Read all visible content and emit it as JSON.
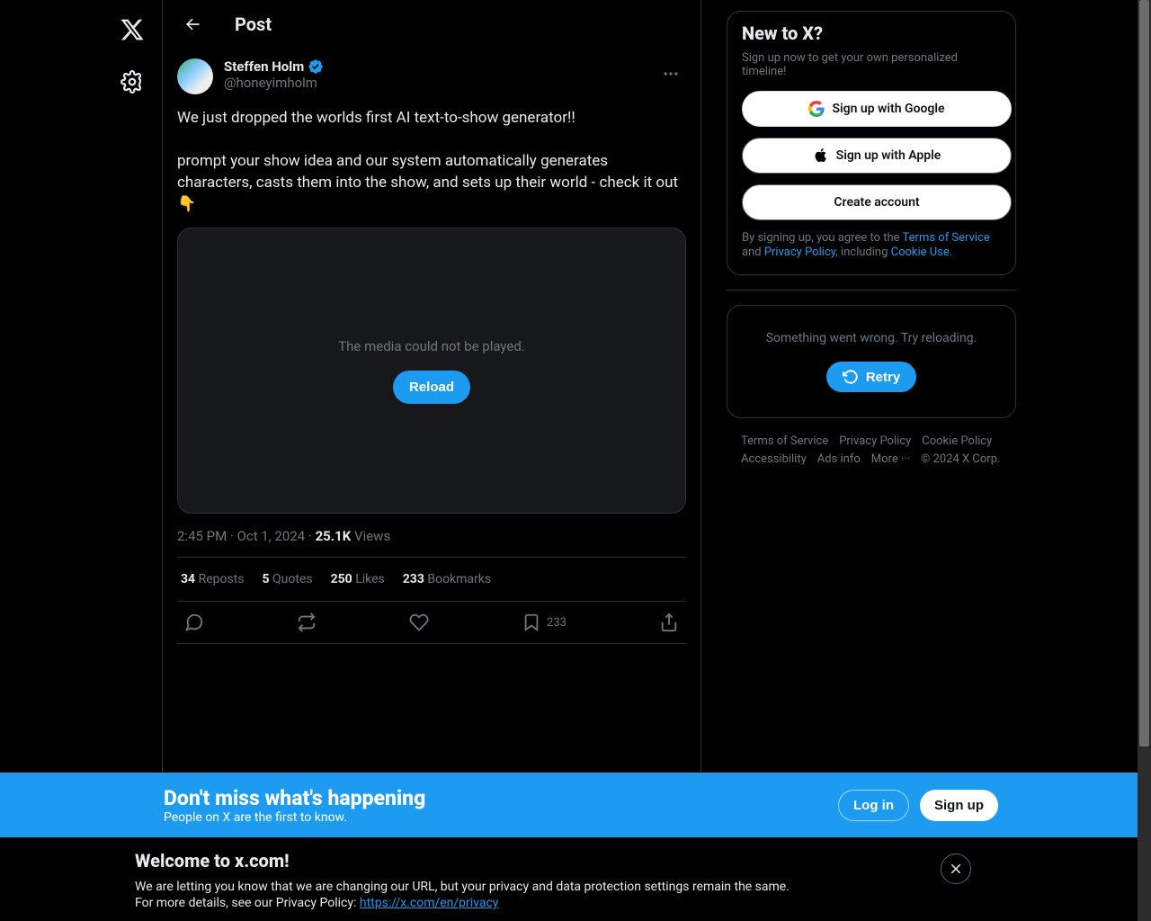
{
  "header": {
    "title": "Post"
  },
  "post": {
    "author_name": "Steffen Holm",
    "author_handle": "@honeyimholm",
    "body": "We just dropped the worlds first AI text-to-show generator!!\n\nprompt your show idea and our system automatically generates characters, casts them into the show, and sets up their world - check it out 👇",
    "media_error": "The media could not be played.",
    "reload_label": "Reload",
    "timestamp": "2:45 PM · Oct 1, 2024",
    "views_count": "25.1K",
    "views_label": "Views",
    "stats": {
      "reposts_n": "34",
      "reposts_l": "Reposts",
      "quotes_n": "5",
      "quotes_l": "Quotes",
      "likes_n": "250",
      "likes_l": "Likes",
      "bookmarks_n": "233",
      "bookmarks_l": "Bookmarks"
    },
    "bookmark_action_count": "233"
  },
  "signup": {
    "title": "New to X?",
    "subtitle": "Sign up now to get your own personalized timeline!",
    "google": "Sign up with Google",
    "apple": "Sign up with Apple",
    "create": "Create account",
    "tos_pre": "By signing up, you agree to the ",
    "tos_link": "Terms of Service",
    "tos_and": " and ",
    "pp_link": "Privacy Policy",
    "tos_inc": ", including ",
    "cu_link": "Cookie Use."
  },
  "error_box": {
    "msg": "Something went wrong. Try reloading.",
    "retry": "Retry"
  },
  "footer": {
    "l1": "Terms of Service",
    "l2": "Privacy Policy",
    "l3": "Cookie Policy",
    "l4": "Accessibility",
    "l5": "Ads info",
    "l6": "More ···",
    "copyright": "© 2024 X Corp."
  },
  "banner_blue": {
    "title": "Don't miss what's happening",
    "subtitle": "People on X are the first to know.",
    "login": "Log in",
    "signup": "Sign up"
  },
  "banner_black": {
    "title": "Welcome to x.com!",
    "line1": "We are letting you know that we are changing our URL, but your privacy and data protection settings remain the same.",
    "line2_pre": "For more details, see our Privacy Policy: ",
    "line2_link": "https://x.com/en/privacy"
  }
}
